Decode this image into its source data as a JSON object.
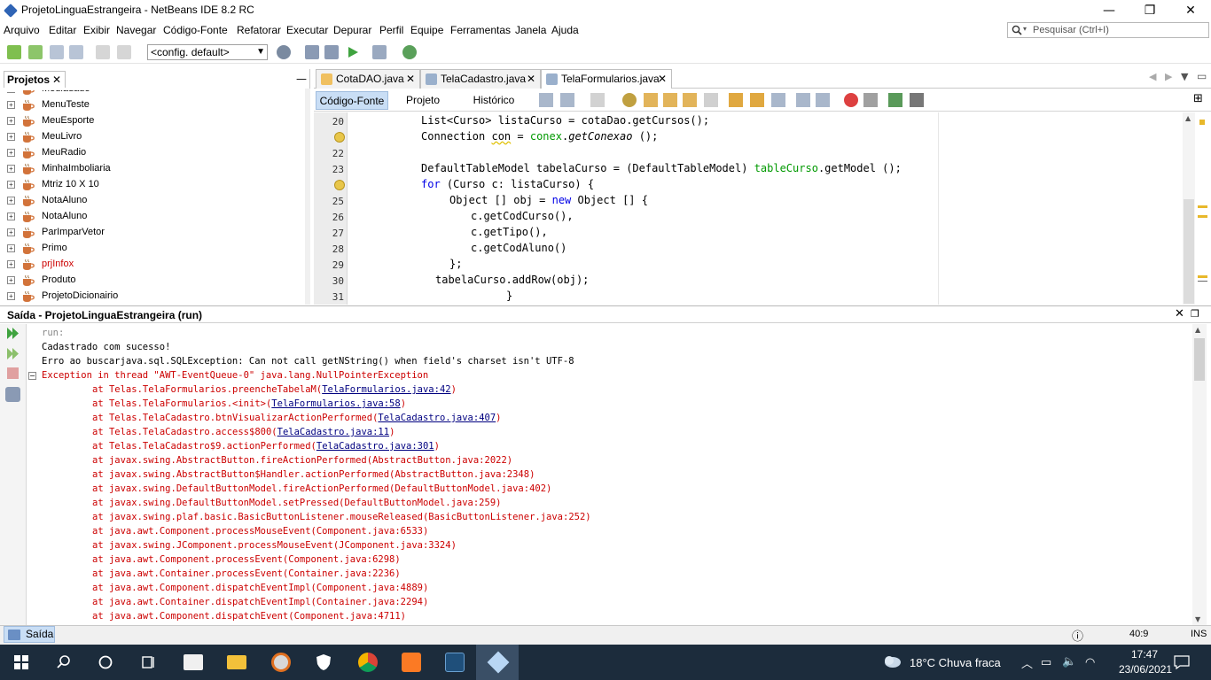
{
  "window": {
    "title": "ProjetoLinguaEstrangeira - NetBeans IDE 8.2 RC",
    "controls": {
      "minimize": "—",
      "maximize": "❐",
      "close": "✕"
    }
  },
  "menu": [
    "Arquivo",
    "Editar",
    "Exibir",
    "Navegar",
    "Código-Fonte",
    "Refatorar",
    "Executar",
    "Depurar",
    "Perfil",
    "Equipe",
    "Ferramentas",
    "Janela",
    "Ajuda"
  ],
  "search": {
    "placeholder": "Pesquisar (Ctrl+I)"
  },
  "toolbar": {
    "config": "<config. default>"
  },
  "projects": {
    "tab_label": "Projetos",
    "items": [
      {
        "label": "Mediadade",
        "color": "#000000"
      },
      {
        "label": "MenuTeste",
        "color": "#000000"
      },
      {
        "label": "MeuEsporte",
        "color": "#000000"
      },
      {
        "label": "MeuLivro",
        "color": "#000000"
      },
      {
        "label": "MeuRadio",
        "color": "#000000"
      },
      {
        "label": "MinhaImboliaria",
        "color": "#000000"
      },
      {
        "label": "Mtriz 10 X 10",
        "color": "#000000"
      },
      {
        "label": "NotaAluno",
        "color": "#000000"
      },
      {
        "label": "NotaAluno",
        "color": "#000000"
      },
      {
        "label": "ParImparVetor",
        "color": "#000000"
      },
      {
        "label": "Primo",
        "color": "#000000"
      },
      {
        "label": "prjInfox",
        "color": "#cc0000"
      },
      {
        "label": "Produto",
        "color": "#000000"
      },
      {
        "label": "ProjetoDicionairio",
        "color": "#000000"
      }
    ]
  },
  "editor": {
    "tabs": [
      {
        "label": "CotaDAO.java",
        "active": false
      },
      {
        "label": "TelaCadastro.java",
        "active": false
      },
      {
        "label": "TelaFormularios.java",
        "active": true
      }
    ],
    "subtabs": [
      {
        "label": "Código-Fonte",
        "active": true
      },
      {
        "label": "Projeto",
        "active": false
      },
      {
        "label": "Histórico",
        "active": false
      }
    ],
    "line_numbers": [
      "20",
      "",
      "22",
      "23",
      "",
      "25",
      "26",
      "27",
      "28",
      "29",
      "30",
      "31"
    ]
  },
  "output": {
    "title": "Saída - ProjetoLinguaEstrangeira (run)",
    "lines": [
      {
        "text": "run:",
        "style": "gray",
        "indent": 0
      },
      {
        "text": "Cadastrado com sucesso!",
        "style": "blk",
        "indent": 0
      },
      {
        "text": "Erro ao buscarjava.sql.SQLException: Can not call getNString() when field's charset isn't UTF-8",
        "style": "blk",
        "indent": 0
      },
      {
        "text": "Exception in thread \"AWT-EventQueue-0\" java.lang.NullPointerException",
        "style": "red",
        "indent": 0
      },
      {
        "text": "at Telas.TelaFormularios.preencheTabelaM(",
        "link": "TelaFormularios.java:42",
        "tail": ")",
        "style": "red",
        "indent": 1
      },
      {
        "text": "at Telas.TelaFormularios.<init>(",
        "link": "TelaFormularios.java:58",
        "tail": ")",
        "style": "red",
        "indent": 1
      },
      {
        "text": "at Telas.TelaCadastro.btnVisualizarActionPerformed(",
        "link": "TelaCadastro.java:407",
        "tail": ")",
        "style": "red",
        "indent": 1
      },
      {
        "text": "at Telas.TelaCadastro.access$800(",
        "link": "TelaCadastro.java:11",
        "tail": ")",
        "style": "red",
        "indent": 1
      },
      {
        "text": "at Telas.TelaCadastro$9.actionPerformed(",
        "link": "TelaCadastro.java:301",
        "tail": ")",
        "style": "red",
        "indent": 1
      },
      {
        "text": "at javax.swing.AbstractButton.fireActionPerformed(AbstractButton.java:2022)",
        "style": "red",
        "indent": 1
      },
      {
        "text": "at javax.swing.AbstractButton$Handler.actionPerformed(AbstractButton.java:2348)",
        "style": "red",
        "indent": 1
      },
      {
        "text": "at javax.swing.DefaultButtonModel.fireActionPerformed(DefaultButtonModel.java:402)",
        "style": "red",
        "indent": 1
      },
      {
        "text": "at javax.swing.DefaultButtonModel.setPressed(DefaultButtonModel.java:259)",
        "style": "red",
        "indent": 1
      },
      {
        "text": "at javax.swing.plaf.basic.BasicButtonListener.mouseReleased(BasicButtonListener.java:252)",
        "style": "red",
        "indent": 1
      },
      {
        "text": "at java.awt.Component.processMouseEvent(Component.java:6533)",
        "style": "red",
        "indent": 1
      },
      {
        "text": "at javax.swing.JComponent.processMouseEvent(JComponent.java:3324)",
        "style": "red",
        "indent": 1
      },
      {
        "text": "at java.awt.Component.processEvent(Component.java:6298)",
        "style": "red",
        "indent": 1
      },
      {
        "text": "at java.awt.Container.processEvent(Container.java:2236)",
        "style": "red",
        "indent": 1
      },
      {
        "text": "at java.awt.Component.dispatchEventImpl(Component.java:4889)",
        "style": "red",
        "indent": 1
      },
      {
        "text": "at java.awt.Container.dispatchEventImpl(Container.java:2294)",
        "style": "red",
        "indent": 1
      },
      {
        "text": "at java.awt.Component.dispatchEvent(Component.java:4711)",
        "style": "red",
        "indent": 1
      }
    ]
  },
  "status": {
    "output_tab": "Saída",
    "position": "40:9",
    "mode": "INS"
  },
  "taskbar": {
    "weather": "18°C  Chuva fraca",
    "time": "17:47",
    "date": "23/06/2021"
  },
  "colors": {
    "keyword": "#0000e6",
    "field": "#009900",
    "error": "#cc0000",
    "taskbar": "#1c2c3c",
    "selection": "#c9def5"
  }
}
